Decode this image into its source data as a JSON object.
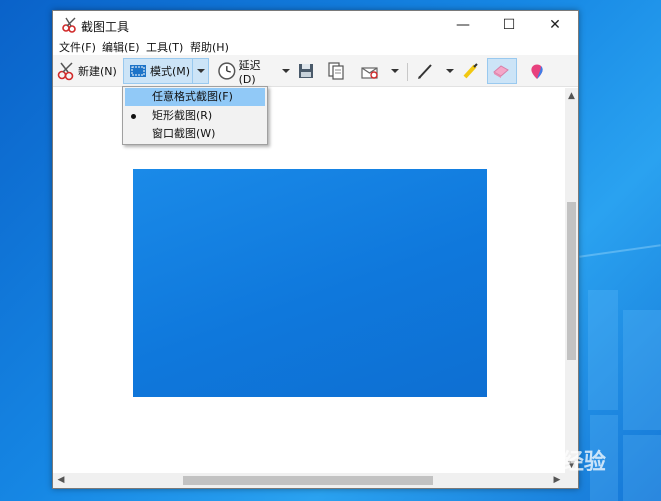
{
  "window": {
    "title": "截图工具",
    "controls": {
      "minimize": "—",
      "maximize": "☐",
      "close": "✕"
    }
  },
  "menu": [
    "文件(F)",
    "编辑(E)",
    "工具(T)",
    "帮助(H)"
  ],
  "toolbar": {
    "new_label": "新建(N)",
    "mode_label": "模式(M)",
    "delay_label": "延迟(D)"
  },
  "mode_menu": {
    "items": [
      {
        "label": "任意格式截图(F)",
        "highlighted": true,
        "selected": false
      },
      {
        "label": "矩形截图(R)",
        "highlighted": false,
        "selected": true
      },
      {
        "label": "窗口截图(W)",
        "highlighted": false,
        "selected": false
      }
    ]
  },
  "watermark": {
    "text": "Bai 经验"
  },
  "colors": {
    "accent": "#cce4f7",
    "highlight": "#91c9f7",
    "captured_fill": "#1582e3"
  }
}
